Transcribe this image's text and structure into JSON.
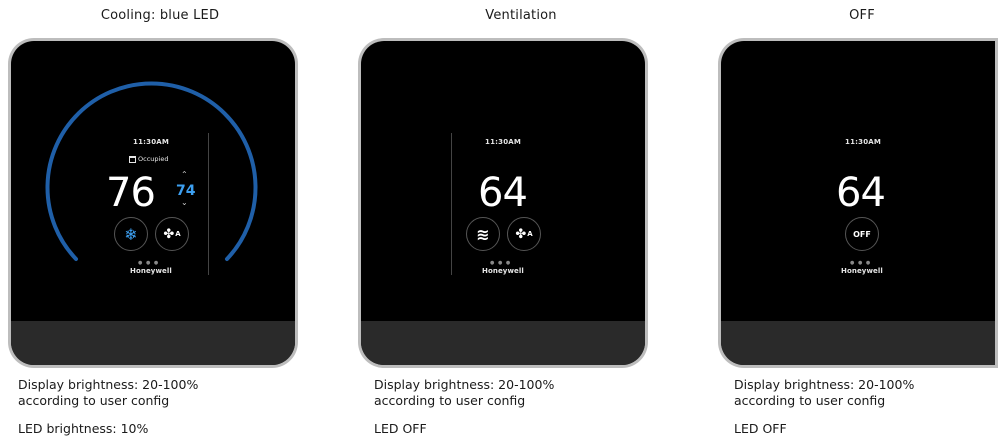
{
  "panels": [
    {
      "title": "Cooling: blue LED",
      "device": {
        "time": "11:30AM",
        "occupied_label": "Occupied",
        "temperature": "76",
        "setpoint": "74",
        "mode_icon": "snowflake-icon",
        "fan_icon": "fan-icon",
        "fan_sub": "A",
        "dots": "● ● ●",
        "brand": "Honeywell",
        "led_color": "#1f5fa8"
      },
      "caption_line1": "Display brightness: 20-100%",
      "caption_line2": "according to user config",
      "led_text": "LED brightness: 10%"
    },
    {
      "title": "Ventilation",
      "device": {
        "time": "11:30AM",
        "temperature": "64",
        "mode_icon": "ventilation-waves-icon",
        "mode_glyph": "≋",
        "fan_icon": "fan-icon",
        "fan_sub": "A",
        "dots": "● ● ●",
        "brand": "Honeywell"
      },
      "caption_line1": "Display brightness: 20-100%",
      "caption_line2": "according to user config",
      "led_text": "LED OFF"
    },
    {
      "title": "OFF",
      "device": {
        "time": "11:30AM",
        "temperature": "64",
        "off_label": "OFF",
        "dots": "● ● ●",
        "brand": "Honeywell"
      },
      "caption_line1": "Display brightness: 20-100%",
      "caption_line2": "according to user config",
      "led_text": "LED OFF"
    }
  ],
  "glyphs": {
    "snowflake": "❄",
    "fan": "✤",
    "chevron_up": "⌃",
    "chevron_down": "⌄"
  }
}
